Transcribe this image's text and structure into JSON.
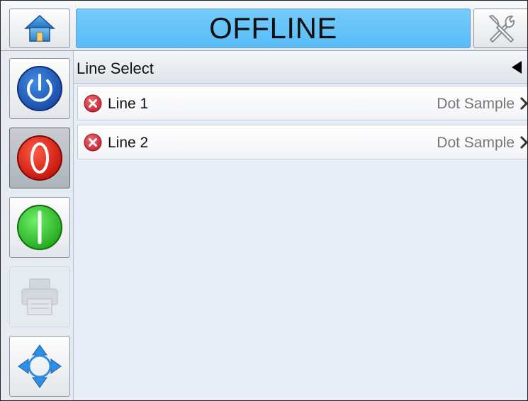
{
  "header": {
    "status": "OFFLINE",
    "status_color": "#5ec1f9",
    "home_icon": "home-icon",
    "tools_icon": "tools-icon"
  },
  "sidebar": {
    "buttons": [
      {
        "name": "power",
        "icon": "power-icon",
        "color": "#1e5fbf"
      },
      {
        "name": "stop",
        "icon": "stop-icon",
        "color": "#e0231a",
        "state": "selected"
      },
      {
        "name": "start",
        "icon": "start-icon",
        "color": "#2fcf2a"
      },
      {
        "name": "print",
        "icon": "printer-icon",
        "state": "disabled"
      },
      {
        "name": "navigate",
        "icon": "navigation-arrows-icon",
        "color": "#2f8fe6"
      }
    ]
  },
  "section": {
    "title": "Line Select"
  },
  "lines": [
    {
      "name": "Line 1",
      "value": "Dot Sample",
      "status_icon": "error-icon"
    },
    {
      "name": "Line 2",
      "value": "Dot Sample",
      "status_icon": "error-icon"
    }
  ]
}
